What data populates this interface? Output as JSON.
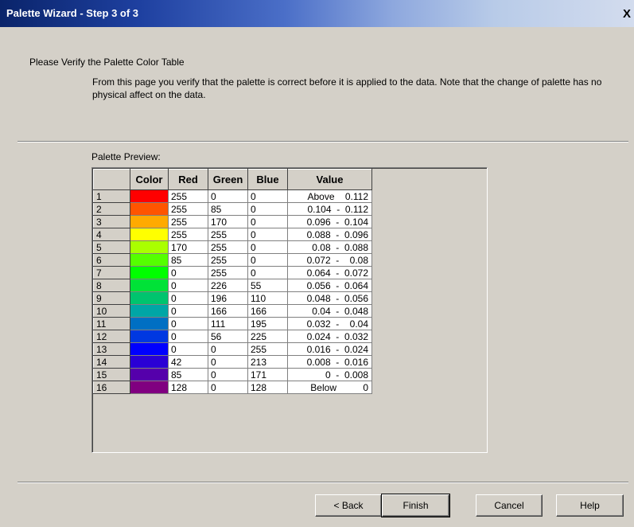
{
  "window": {
    "title": "Palette Wizard - Step 3 of 3",
    "close_label": "X"
  },
  "page": {
    "heading": "Please Verify the Palette Color Table",
    "description": "From this page you verify that the palette is correct before it is applied to the data. Note that the change of palette has no physical affect on the data.",
    "preview_label": "Palette Preview:"
  },
  "table": {
    "columns": [
      "",
      "Color",
      "Red",
      "Green",
      "Blue",
      "Value"
    ],
    "rows": [
      {
        "index": "1",
        "color": "#ff0000",
        "red": "255",
        "green": "0",
        "blue": "0",
        "value": "Above    0.112"
      },
      {
        "index": "2",
        "color": "#ff5500",
        "red": "255",
        "green": "85",
        "blue": "0",
        "value": "0.104  -  0.112"
      },
      {
        "index": "3",
        "color": "#ffaa00",
        "red": "255",
        "green": "170",
        "blue": "0",
        "value": "0.096  -  0.104"
      },
      {
        "index": "4",
        "color": "#ffff00",
        "red": "255",
        "green": "255",
        "blue": "0",
        "value": "0.088  -  0.096"
      },
      {
        "index": "5",
        "color": "#aaff00",
        "red": "170",
        "green": "255",
        "blue": "0",
        "value": "0.08  -  0.088"
      },
      {
        "index": "6",
        "color": "#55ff00",
        "red": "85",
        "green": "255",
        "blue": "0",
        "value": "0.072  -    0.08"
      },
      {
        "index": "7",
        "color": "#00ff00",
        "red": "0",
        "green": "255",
        "blue": "0",
        "value": "0.064  -  0.072"
      },
      {
        "index": "8",
        "color": "#00e237",
        "red": "0",
        "green": "226",
        "blue": "55",
        "value": "0.056  -  0.064"
      },
      {
        "index": "9",
        "color": "#00c46e",
        "red": "0",
        "green": "196",
        "blue": "110",
        "value": "0.048  -  0.056"
      },
      {
        "index": "10",
        "color": "#00a6a6",
        "red": "0",
        "green": "166",
        "blue": "166",
        "value": "0.04  -  0.048"
      },
      {
        "index": "11",
        "color": "#006fc3",
        "red": "0",
        "green": "111",
        "blue": "195",
        "value": "0.032  -    0.04"
      },
      {
        "index": "12",
        "color": "#0038e1",
        "red": "0",
        "green": "56",
        "blue": "225",
        "value": "0.024  -  0.032"
      },
      {
        "index": "13",
        "color": "#0000ff",
        "red": "0",
        "green": "0",
        "blue": "255",
        "value": "0.016  -  0.024"
      },
      {
        "index": "14",
        "color": "#2a00d5",
        "red": "42",
        "green": "0",
        "blue": "213",
        "value": "0.008  -  0.016"
      },
      {
        "index": "15",
        "color": "#5500ab",
        "red": "85",
        "green": "0",
        "blue": "171",
        "value": "0  -  0.008"
      },
      {
        "index": "16",
        "color": "#800080",
        "red": "128",
        "green": "0",
        "blue": "128",
        "value": "Below          0"
      }
    ]
  },
  "buttons": {
    "back": "< Back",
    "finish": "Finish",
    "cancel": "Cancel",
    "help": "Help"
  }
}
